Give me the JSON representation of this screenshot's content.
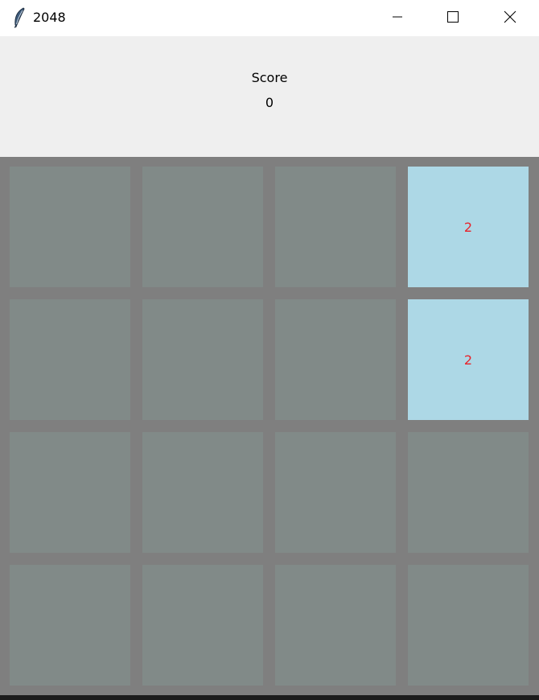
{
  "window": {
    "title": "2048",
    "icon": "feather-icon",
    "controls": [
      "minimize-icon",
      "maximize-icon",
      "close-icon"
    ]
  },
  "score": {
    "label": "Score",
    "value": "0"
  },
  "board": {
    "rows": [
      [
        "",
        "",
        "",
        "2"
      ],
      [
        "",
        "",
        "",
        "2"
      ],
      [
        "",
        "",
        "",
        ""
      ],
      [
        "",
        "",
        "",
        ""
      ]
    ]
  },
  "colors": {
    "board_bg": "#7f7f7f",
    "empty_tile": "#818a88",
    "tile_2_bg": "#add8e6",
    "tile_text": "#e8222a",
    "panel_bg": "#efefef"
  }
}
